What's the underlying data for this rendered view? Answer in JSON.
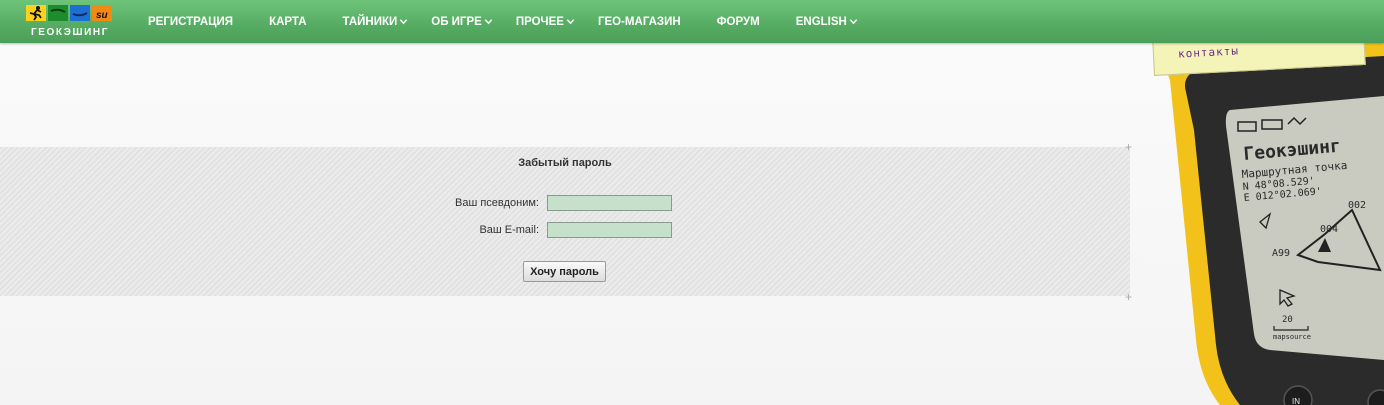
{
  "logo": {
    "text": "ГЕОКЭШИНГ",
    "tile_colors": [
      "#ffd21a",
      "#1c8c2c",
      "#1d6fd1",
      "#f08a14"
    ],
    "tile_badge": "su"
  },
  "nav": {
    "items": [
      {
        "label": "Регистрация",
        "has_dropdown": false
      },
      {
        "label": "Карта",
        "has_dropdown": false
      },
      {
        "label": "Тайники",
        "has_dropdown": true
      },
      {
        "label": "Об игре",
        "has_dropdown": true
      },
      {
        "label": "Прочее",
        "has_dropdown": true
      },
      {
        "label": "Гео-магазин",
        "has_dropdown": false
      },
      {
        "label": "Форум",
        "has_dropdown": false
      },
      {
        "label": "English",
        "has_dropdown": true
      }
    ]
  },
  "form": {
    "title": "Забытый пароль",
    "nickname_label": "Ваш псевдоним:",
    "nickname_value": "",
    "email_label": "Ваш E-mail:",
    "email_value": "",
    "submit_label": "Хочу пароль"
  },
  "side": {
    "contacts_label": "контакты",
    "gps_title": "Геокэшинг",
    "gps_waypoint_label": "Маршрутная точка",
    "gps_lat": "N  48°08.529'",
    "gps_lon": "E 012°02.069'",
    "gps_points": [
      "002",
      "004",
      "A99"
    ],
    "gps_scale": "20",
    "gps_brand": "mapsource",
    "gps_button": "IN"
  },
  "colors": {
    "nav_bar": "#57ad64",
    "input_bg": "#c5e1cc",
    "device_body": "#f2c21a"
  }
}
